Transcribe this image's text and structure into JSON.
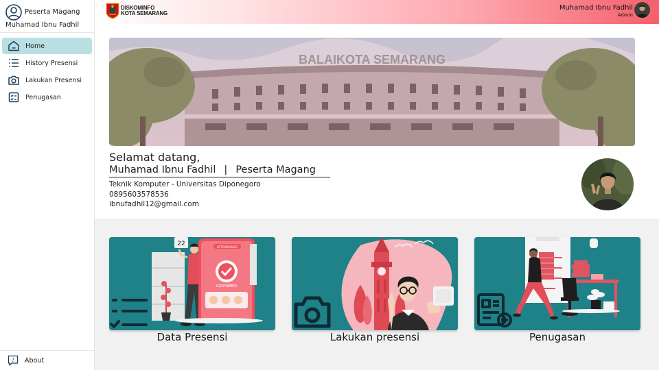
{
  "sidebar": {
    "role": "Peserta Magang",
    "name": "Muhamad Ibnu Fadhil",
    "items": [
      {
        "label": "Home",
        "icon": "home-icon",
        "active": true
      },
      {
        "label": "History Presensi",
        "icon": "list-icon",
        "active": false
      },
      {
        "label": "Lakukan Presensi",
        "icon": "camera-icon",
        "active": false
      },
      {
        "label": "Penugasan",
        "icon": "checklist-icon",
        "active": false
      }
    ],
    "about_label": "About"
  },
  "topbar": {
    "brand_line1": "DISKOMINFO",
    "brand_line2": "KOTA SEMARANG",
    "user_name": "Muhamad Ibnu Fadhil",
    "user_role": "Admin"
  },
  "welcome": {
    "banner_text": "BALAIKOTA SEMARANG",
    "greeting": "Selamat datang,",
    "full_name": "Muhamad Ibnu Fadhil",
    "separator": "|",
    "role": "Peserta Magang",
    "education": "Teknik Komputer - Universitas Diponegoro",
    "phone": "0895603578536",
    "email": "ibnufadhil12@gmail.com"
  },
  "cards": [
    {
      "label": "Data Presensi",
      "calendar_day": "22",
      "phone_title": "ATTENDANCE",
      "phone_status": "CONFIRMED"
    },
    {
      "label": "Lakukan presensi"
    },
    {
      "label": "Penugasan"
    }
  ],
  "colors": {
    "card_bg": "#1f8288",
    "accent_red": "#f0505d",
    "active_menu": "#b8dfe2"
  }
}
